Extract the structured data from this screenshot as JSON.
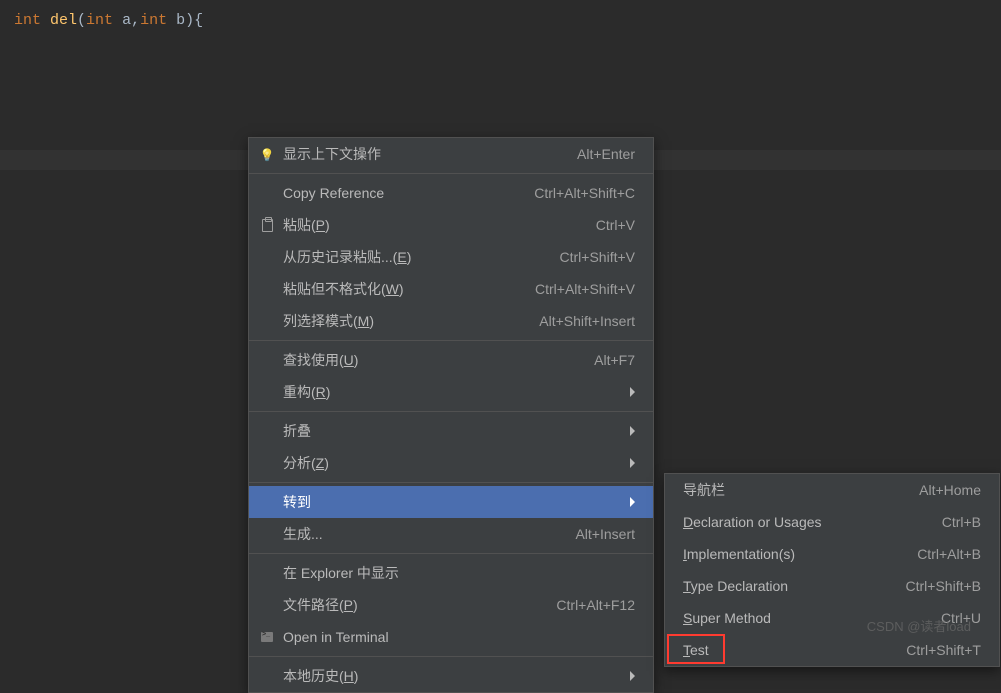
{
  "code": {
    "line1": {
      "type1": "int ",
      "fnName": "del",
      "open": "(",
      "type2": "int ",
      "p1": "a",
      "comma": ",",
      "type3": "int ",
      "p2": "b",
      "close": "){"
    }
  },
  "contextMenu": {
    "items": [
      {
        "icon": "bulb",
        "label": "显示上下文操作",
        "shortcut": "Alt+Enter",
        "arrow": false
      },
      null,
      {
        "icon": "",
        "label": "Copy Reference",
        "shortcut": "Ctrl+Alt+Shift+C",
        "arrow": false
      },
      {
        "icon": "paste",
        "label": "粘贴(P)",
        "underlineChar": "P",
        "shortcut": "Ctrl+V",
        "arrow": false
      },
      {
        "icon": "",
        "label": "从历史记录粘贴...(E)",
        "underlineChar": "E",
        "shortcut": "Ctrl+Shift+V",
        "arrow": false
      },
      {
        "icon": "",
        "label": "粘贴但不格式化(W)",
        "underlineChar": "W",
        "shortcut": "Ctrl+Alt+Shift+V",
        "arrow": false
      },
      {
        "icon": "",
        "label": "列选择模式(M)",
        "underlineChar": "M",
        "shortcut": "Alt+Shift+Insert",
        "arrow": false
      },
      null,
      {
        "icon": "",
        "label": "查找使用(U)",
        "underlineChar": "U",
        "shortcut": "Alt+F7",
        "arrow": false
      },
      {
        "icon": "",
        "label": "重构(R)",
        "underlineChar": "R",
        "shortcut": "",
        "arrow": true
      },
      null,
      {
        "icon": "",
        "label": "折叠",
        "shortcut": "",
        "arrow": true
      },
      {
        "icon": "",
        "label": "分析(Z)",
        "underlineChar": "Z",
        "shortcut": "",
        "arrow": true
      },
      null,
      {
        "icon": "",
        "label": "转到",
        "shortcut": "",
        "arrow": true,
        "highlighted": true
      },
      {
        "icon": "",
        "label": "生成...",
        "shortcut": "Alt+Insert",
        "arrow": false
      },
      null,
      {
        "icon": "",
        "label": "在 Explorer 中显示",
        "shortcut": "",
        "arrow": false
      },
      {
        "icon": "",
        "label": "文件路径(P)",
        "underlineChar": "P",
        "shortcut": "Ctrl+Alt+F12",
        "arrow": false
      },
      {
        "icon": "terminal",
        "label": "Open in Terminal",
        "shortcut": "",
        "arrow": false
      },
      null,
      {
        "icon": "",
        "label": "本地历史(H)",
        "underlineChar": "H",
        "shortcut": "",
        "arrow": true
      }
    ]
  },
  "submenu": {
    "items": [
      {
        "label": "导航栏",
        "shortcut": "Alt+Home"
      },
      {
        "label": "Declaration or Usages",
        "underlineChar": "D",
        "shortcut": "Ctrl+B"
      },
      {
        "label": "Implementation(s)",
        "underlineChar": "I",
        "shortcut": "Ctrl+Alt+B"
      },
      {
        "label": "Type Declaration",
        "underlineChar": "T",
        "shortcut": "Ctrl+Shift+B"
      },
      {
        "label": "Super Method",
        "underlineChar": "S",
        "shortcut": "Ctrl+U"
      },
      {
        "label": "Test",
        "underlineChar": "T",
        "shortcut": "Ctrl+Shift+T",
        "redBox": true
      }
    ]
  },
  "watermark": "CSDN @读者load"
}
